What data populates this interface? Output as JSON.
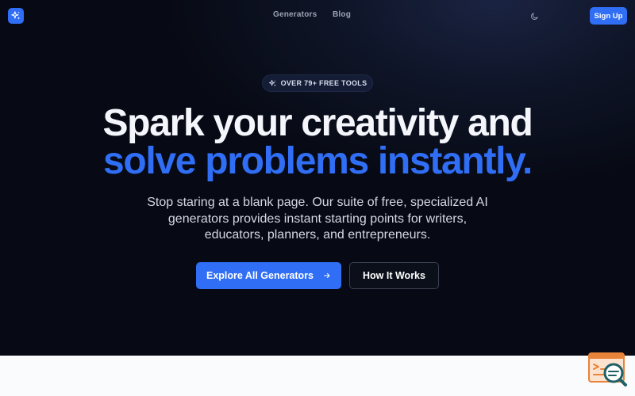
{
  "nav": {
    "logo_icon": "sparkles-icon",
    "links": [
      {
        "label": "Generators"
      },
      {
        "label": "Blog"
      }
    ],
    "theme_toggle_icon": "moon-icon",
    "signup_label": "Sign Up"
  },
  "hero": {
    "badge_icon": "sparkles-icon",
    "badge_text": "OVER 79+ FREE TOOLS",
    "headline_line1": "Spark your creativity and",
    "headline_line2": "solve problems instantly.",
    "subtitle": "Stop staring at a blank page. Our suite of free, specialized AI generators provides instant starting points for writers, educators, planners, and entrepreneurs.",
    "primary_cta": "Explore All Generators",
    "primary_cta_icon": "arrow-right-icon",
    "secondary_cta": "How It Works"
  },
  "widget": {
    "icon": "chat-search-icon"
  },
  "colors": {
    "accent": "#2f6ef5",
    "background": "#070a14",
    "headline": "#f4f6fb",
    "widget_orange": "#e8833a",
    "widget_teal": "#1f5f66"
  }
}
